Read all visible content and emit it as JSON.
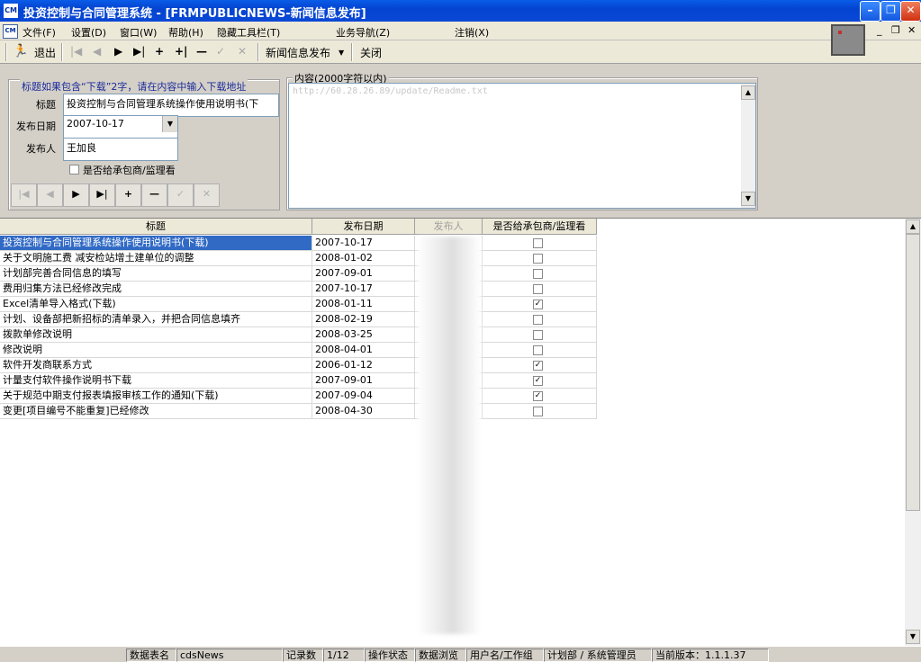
{
  "window": {
    "title": "投资控制与合同管理系统 - [FRMPUBLICNEWS-新闻信息发布]",
    "icon_label": "CM"
  },
  "menu": {
    "items": [
      "文件(F)",
      "设置(D)",
      "窗口(W)",
      "帮助(H)",
      "隐藏工具栏(T)",
      "业务导航(Z)",
      "注销(X)"
    ]
  },
  "toolbar": {
    "exit_label": "退出",
    "module_dropdown": "新闻信息发布",
    "close_label": "关闭"
  },
  "form": {
    "hint": "标题如果包含“下载”2字，请在内容中输入下载地址",
    "title_label": "标题",
    "title_value": "投资控制与合同管理系统操作使用说明书(下",
    "date_label": "发布日期",
    "date_value": "2007-10-17",
    "publisher_label": "发布人",
    "publisher_value": "王加良",
    "visible_checkbox_label": "是否给承包商/监理看",
    "visible_checked": false
  },
  "content": {
    "legend": "内容(2000字符以内)",
    "text": "http://60.28.26.89/update/Readme.txt"
  },
  "grid": {
    "columns": [
      "标题",
      "发布日期",
      "发布人",
      "是否给承包商/监理看"
    ],
    "rows": [
      {
        "title": "投资控制与合同管理系统操作使用说明书(下载)",
        "date": "2007-10-17",
        "visible": false,
        "selected": true
      },
      {
        "title": "关于文明施工费 减安检站增土建单位的调整",
        "date": "2008-01-02",
        "visible": false
      },
      {
        "title": "计划部完善合同信息的填写",
        "date": "2007-09-01",
        "visible": false
      },
      {
        "title": "费用归集方法已经修改完成",
        "date": "2007-10-17",
        "visible": false
      },
      {
        "title": "Excel清单导入格式(下载)",
        "date": "2008-01-11",
        "visible": true
      },
      {
        "title": "计划、设备部把新招标的清单录入，并把合同信息填齐",
        "date": "2008-02-19",
        "visible": false
      },
      {
        "title": "拨款单修改说明",
        "date": "2008-03-25",
        "visible": false
      },
      {
        "title": "修改说明",
        "date": "2008-04-01",
        "visible": false
      },
      {
        "title": "软件开发商联系方式",
        "date": "2006-01-12",
        "visible": true
      },
      {
        "title": "计量支付软件操作说明书下载",
        "date": "2007-09-01",
        "visible": true
      },
      {
        "title": "关于规范中期支付报表填报审核工作的通知(下载)",
        "date": "2007-09-04",
        "visible": true
      },
      {
        "title": "变更[项目编号不能重复]已经修改",
        "date": "2008-04-30",
        "visible": false
      }
    ]
  },
  "status": {
    "table_label": "数据表名",
    "table_value": "cdsNews",
    "records_label": "记录数",
    "records_value": "1/12",
    "state_label": "操作状态",
    "state_value": "数据浏览",
    "user_label": "用户名/工作组",
    "user_value": "计划部 / 系统管理员",
    "version": "当前版本：1.1.1.37"
  },
  "colors": {
    "titlebar": "#0344d0",
    "selection": "#316ac5",
    "face": "#d4d0c8"
  }
}
